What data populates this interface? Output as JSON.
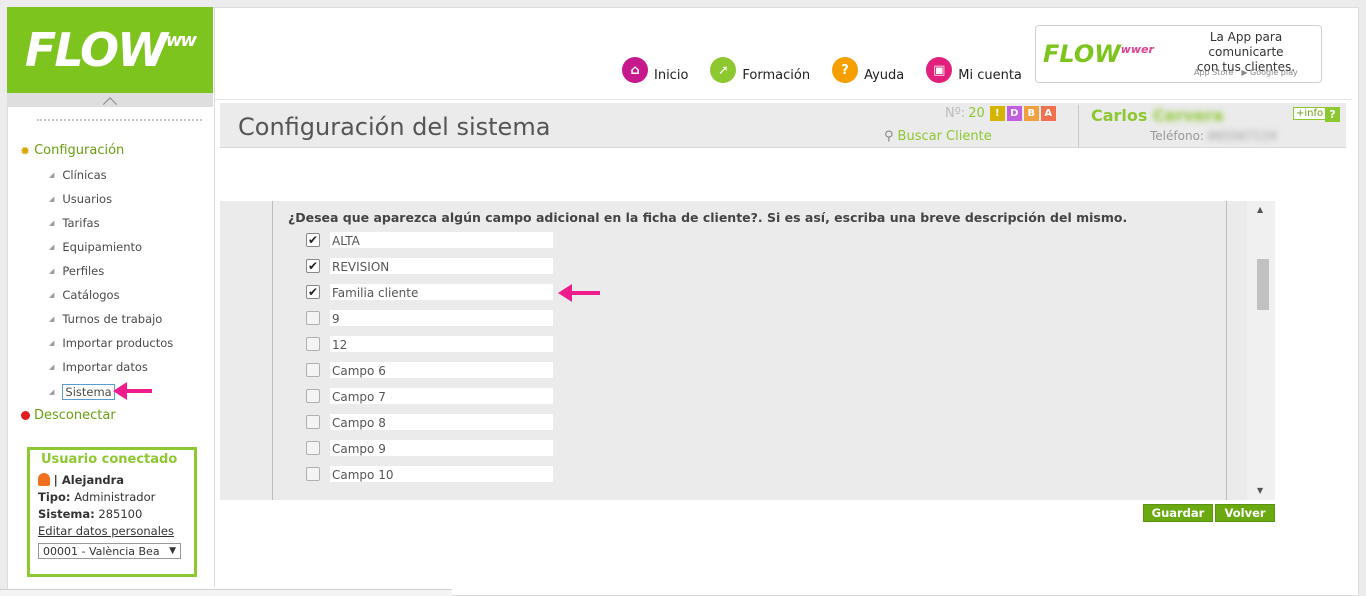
{
  "brand": {
    "logo": "FLOW",
    "logo_sup": "ww"
  },
  "sidebar": {
    "root_label": "Configuración",
    "items": [
      {
        "label": "Clínicas"
      },
      {
        "label": "Usuarios"
      },
      {
        "label": "Tarifas"
      },
      {
        "label": "Equipamiento"
      },
      {
        "label": "Perfiles"
      },
      {
        "label": "Catálogos"
      },
      {
        "label": "Turnos de trabajo"
      },
      {
        "label": "Importar productos"
      },
      {
        "label": "Importar datos"
      },
      {
        "label": "Sistema",
        "active": true
      }
    ],
    "logout_label": "Desconectar"
  },
  "user_box": {
    "title": "Usuario conectado",
    "name": "| Alejandra",
    "tipo_label": "Tipo:",
    "tipo_value": "Administrador",
    "sistema_label": "Sistema:",
    "sistema_value": "285100",
    "edit_link": "Editar datos personales",
    "clinic_select": "00001 - València Bea",
    "select_arrow": "▼"
  },
  "top_nav": [
    {
      "label": "Inicio",
      "icon": "home-icon",
      "color": "#c6198c",
      "glyph": "⌂"
    },
    {
      "label": "Formación",
      "icon": "rocket-icon",
      "color": "#8dc830",
      "glyph": "➚"
    },
    {
      "label": "Ayuda",
      "icon": "help-icon",
      "color": "#f5a000",
      "glyph": "?"
    },
    {
      "label": "Mi cuenta",
      "icon": "briefcase-icon",
      "color": "#e0207a",
      "glyph": "▣"
    }
  ],
  "app_ad": {
    "logo": "FLOW",
    "logo_sup": "wwer",
    "line1": "La App para comunicarte",
    "line2": "con tus clientes.",
    "store1": " App Store",
    "store2": "▶ Google play"
  },
  "title_bar": {
    "page_title": "Configuración del sistema",
    "counter_label": "Nº:",
    "counter_value": "20",
    "badges": [
      {
        "text": "!",
        "color": "#d4b400"
      },
      {
        "text": "D",
        "color": "#c060e0"
      },
      {
        "text": "B",
        "color": "#f0a040"
      },
      {
        "text": "A",
        "color": "#f07050"
      }
    ],
    "search_client": "Buscar Cliente",
    "client_first": "Carlos",
    "client_last": "Cervera",
    "phone_label": "Teléfono:",
    "phone_value": "665567119",
    "info_btn": "+info",
    "help_btn": "?"
  },
  "form": {
    "question": "¿Desea que aparezca algún campo adicional en la ficha de cliente?. Si es así, escriba una breve descripción del mismo.",
    "fields": [
      {
        "checked": true,
        "value": "ALTA"
      },
      {
        "checked": true,
        "value": "REVISION"
      },
      {
        "checked": true,
        "value": "Familia cliente"
      },
      {
        "checked": false,
        "value": "9"
      },
      {
        "checked": false,
        "value": "12"
      },
      {
        "checked": false,
        "value": "Campo 6"
      },
      {
        "checked": false,
        "value": "Campo 7"
      },
      {
        "checked": false,
        "value": "Campo 8"
      },
      {
        "checked": false,
        "value": "Campo 9"
      },
      {
        "checked": false,
        "value": "Campo 10"
      }
    ]
  },
  "actions": {
    "save": "Guardar",
    "back": "Volver"
  },
  "colors": {
    "brand_green": "#7dc41e",
    "accent_pink": "#ee1c8c"
  }
}
